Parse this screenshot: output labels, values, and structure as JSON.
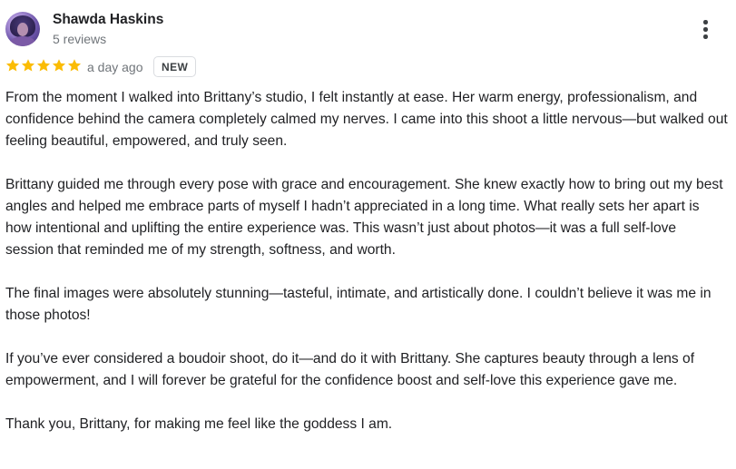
{
  "reviewer": {
    "name": "Shawda Haskins",
    "reviews_count": "5 reviews",
    "avatar_icon": "user-avatar-photo"
  },
  "rating": {
    "stars": 5,
    "max_stars": 5,
    "color": "#fbbc04"
  },
  "date": "a day ago",
  "badge": "NEW",
  "menu_icon": "more-vert-icon",
  "paragraphs": [
    "From the moment I walked into Brittany’s studio, I felt instantly at ease. Her warm energy, professionalism, and confidence behind the camera completely calmed my nerves. I came into this shoot a little nervous—but walked out feeling beautiful, empowered, and truly seen.",
    "Brittany guided me through every pose with grace and encouragement. She knew exactly how to bring out my best angles and helped me embrace parts of myself I hadn’t appreciated in a long time. What really sets her apart is how intentional and uplifting the entire experience was. This wasn’t just about photos—it was a full self-love session that reminded me of my strength, softness, and worth.",
    "The final images were absolutely stunning—tasteful, intimate, and artistically done. I couldn’t believe it was me in those photos!",
    "If you’ve ever considered a boudoir shoot, do it—and do it with Brittany. She captures beauty through a lens of empowerment, and I will forever be grateful for the confidence boost and self-love this experience gave me.",
    "Thank you, Brittany, for making me feel like the goddess I am."
  ]
}
